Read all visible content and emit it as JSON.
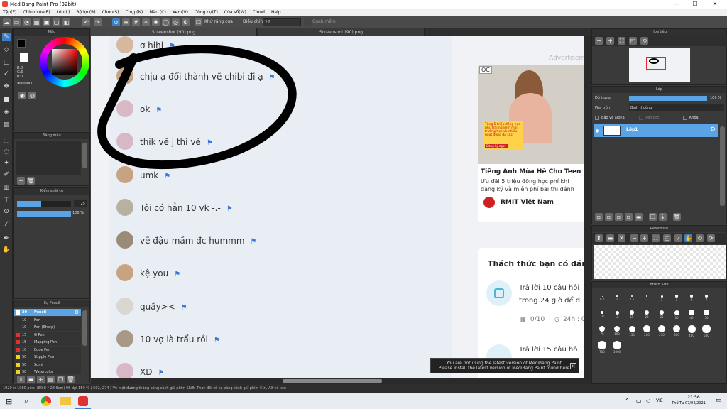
{
  "window": {
    "title": "MediBang Paint Pro (32bit)",
    "minimize": "—",
    "maximize": "☐",
    "close": "✕"
  },
  "menu": [
    "Tệp(F)",
    "Chỉnh sửa(E)",
    "Lớp(L)",
    "Bộ lọc(R)",
    "Chọn(S)",
    "Chụp(N)",
    "Màu (C)",
    "Xem(V)",
    "Công cụ(T)",
    "Cửa sổ(W)",
    "Cloud",
    "Help"
  ],
  "toolbar": {
    "correction_label": "Khử răng cưa",
    "stabilizer_label": "Điều chỉnh",
    "stabilizer_value": "27",
    "snap_label": "Cạnh mềm"
  },
  "tabs": [
    "Screenshot (90).png",
    "Screenshot (90).png"
  ],
  "color_panel": {
    "title": "Màu",
    "r": "R:0",
    "g": "G:0",
    "b": "B:0",
    "hex": "#000000"
  },
  "gradient_panel": {
    "title": "Sáng màu"
  },
  "brush_control": {
    "title": "Kiểm soát cọ",
    "size": "25",
    "opacity": "100 %"
  },
  "brush_list": {
    "title": "Cọ Pencil",
    "items": [
      {
        "size": "20",
        "name": "Pencil",
        "color": "#ffffff",
        "selected": true
      },
      {
        "size": "10",
        "name": "Pen",
        "color": "#333333"
      },
      {
        "size": "10",
        "name": "Pen (Sharp)",
        "color": "#333333"
      },
      {
        "size": "15",
        "name": "G Pen",
        "color": "#e03030"
      },
      {
        "size": "15",
        "name": "Mapping Pen",
        "color": "#e03030"
      },
      {
        "size": "10",
        "name": "Edge Pen",
        "color": "#e03030"
      },
      {
        "size": "50",
        "name": "Stipple Pen",
        "color": "#f0d020"
      },
      {
        "size": "50",
        "name": "Sumi",
        "color": "#f0d020"
      },
      {
        "size": "50",
        "name": "Watercolor",
        "color": "#f0d020"
      }
    ]
  },
  "chat": {
    "messages": [
      {
        "text": "ơ hihi",
        "color": "#d6b7a0"
      },
      {
        "text": "chịu ạ đổi thành vẽ chibi đi ạ",
        "color": "#c7a382"
      },
      {
        "text": "ok",
        "color": "#d9b8c6"
      },
      {
        "text": "thik vẽ j thì vẽ",
        "color": "#d9b8c6"
      },
      {
        "text": "umk",
        "color": "#c7a382"
      },
      {
        "text": "Tôi có hẳn 10 vk -.-",
        "color": "#b8b0a0"
      },
      {
        "text": "vẽ đậu mầm đc hummm",
        "color": "#9a8a78"
      },
      {
        "text": "kệ you",
        "color": "#c7a382"
      },
      {
        "text": "quẩy><",
        "color": "#dad6d0"
      },
      {
        "text": "10 vợ là trẩu rồi",
        "color": "#a89888"
      },
      {
        "text": "XD",
        "color": "#d9b8c6"
      }
    ]
  },
  "ad": {
    "label": "Advertisement",
    "badge": "QC",
    "title": "Tiếng Anh Mùa Hè Cho Teen",
    "body": "Ưu đãi 5 triệu đồng học phí khi đăng ký và miễn phí bài thi đánh giá năng lực.",
    "brand": "RMIT Việt Nam",
    "banner_text": "Tặng 5 triệu đồng học phí, trải nghiệm môi trường học và nhiều hoạt động đa sắc!",
    "cta": "Đăng ký ngay"
  },
  "challenge": {
    "title": "Thách thức bạn có dám",
    "q1": "Trả lời 10 câu hỏi trong 24 giờ để đ",
    "progress": "0/10",
    "time": "24h : 0",
    "q2": "Trả lời 15 câu hỏ"
  },
  "notification": {
    "line1": "You are not using the latest version of MediBang Paint.",
    "line2": "Please install the latest version of MediBang Paint found here."
  },
  "navigator": {
    "title": "Hoa tiêu"
  },
  "layer_panel": {
    "title": "Lớp",
    "opacity_label": "Độ trong",
    "opacity_value": "100 %",
    "blend_label": "Pha trộn",
    "blend_value": "Bình thường",
    "protect_alpha": "Bảo vệ alpha",
    "clipping": "Xén bớt",
    "lock": "Khóa",
    "layer_name": "Lớp1"
  },
  "reference": {
    "title": "Reference"
  },
  "brush_size": {
    "title": "Brush Size",
    "sizes": [
      "0.7",
      "1",
      "1.5",
      "2",
      "3",
      "4",
      "5",
      "7",
      "10",
      "12",
      "15",
      "20",
      "25",
      "30",
      "40",
      "50",
      "70",
      "100",
      "150",
      "200",
      "250",
      "300",
      "400",
      "500",
      "700",
      "1000"
    ]
  },
  "status": {
    "text": "1920 × 1080 pixel  (50.8 * 28.6cm)  96 dpi  150 %  ( 602, 274 )  Vẽ một đường thẳng bằng cách giữ phím Shift, Thay đổi cỡ cọ bằng cách giữ phím Ctrl, Alt và kéo"
  },
  "taskbar": {
    "time": "21:56",
    "date": "Thứ Tư 07/04/2021",
    "lang": "VIE"
  }
}
